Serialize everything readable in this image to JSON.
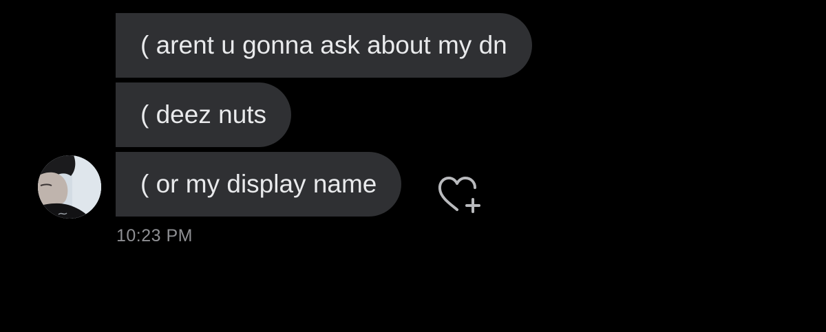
{
  "conversation": {
    "messages": [
      {
        "text": "( arent u gonna ask about my dn"
      },
      {
        "text": "( deez nuts"
      },
      {
        "text": "( or my display name"
      }
    ],
    "timestamp": "10:23 PM"
  },
  "icons": {
    "reaction": "heart-plus-icon",
    "avatar": "sender-avatar"
  },
  "colors": {
    "background": "#000000",
    "bubble": "#2f3033",
    "bubble_text": "#e9eaec",
    "timestamp_text": "#8e8f93",
    "icon_stroke": "#b9babd"
  }
}
